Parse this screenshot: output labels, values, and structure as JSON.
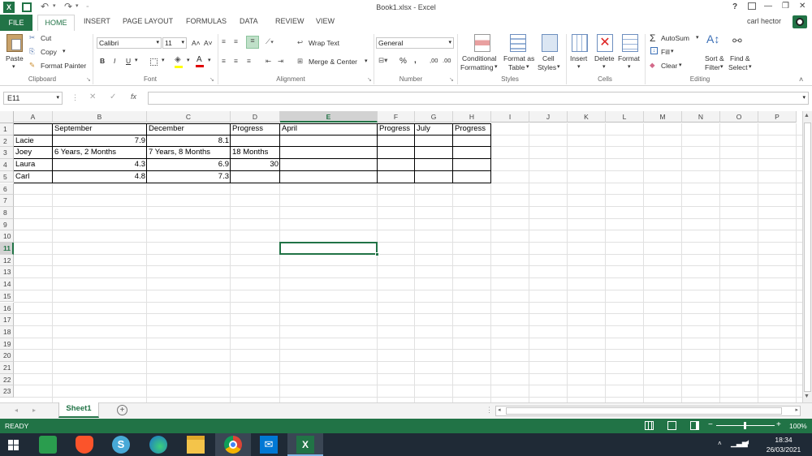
{
  "titlebar": {
    "title": "Book1.xlsx - Excel",
    "help": "?",
    "minimize": "—",
    "restore": "❐",
    "close": "✕"
  },
  "tabs": {
    "file": "FILE",
    "home": "HOME",
    "insert": "INSERT",
    "page_layout": "PAGE LAYOUT",
    "formulas": "FORMULAS",
    "data": "DATA",
    "review": "REVIEW",
    "view": "VIEW"
  },
  "user": {
    "name": "carl hector"
  },
  "ribbon": {
    "clipboard": {
      "paste": "Paste",
      "cut": "Cut",
      "copy": "Copy",
      "format_painter": "Format Painter",
      "group": "Clipboard"
    },
    "font": {
      "family": "Calibri",
      "size": "11",
      "bold": "B",
      "italic": "I",
      "underline": "U",
      "grow": "A˄",
      "shrink": "A˅",
      "group": "Font"
    },
    "alignment": {
      "wrap": "Wrap Text",
      "merge": "Merge & Center",
      "group": "Alignment"
    },
    "number": {
      "format": "General",
      "percent": "%",
      "comma": ",",
      "inc": ",00",
      "dec": ".00",
      "group": "Number"
    },
    "styles": {
      "conditional": "Conditional",
      "conditional2": "Formatting",
      "format_table": "Format as",
      "format_table2": "Table",
      "cell_styles": "Cell",
      "cell_styles2": "Styles",
      "group": "Styles"
    },
    "cells": {
      "insert": "Insert",
      "delete": "Delete",
      "format": "Format",
      "group": "Cells"
    },
    "editing": {
      "autosum": "AutoSum",
      "fill": "Fill",
      "clear": "Clear",
      "sort": "Sort &",
      "sort2": "Filter",
      "find": "Find &",
      "find2": "Select",
      "group": "Editing"
    }
  },
  "formula_bar": {
    "name_box": "E11",
    "fx": "fx",
    "cancel": "✕",
    "enter": "✓",
    "value": ""
  },
  "columns": [
    "A",
    "B",
    "C",
    "D",
    "E",
    "F",
    "G",
    "H",
    "I",
    "J",
    "K",
    "L",
    "M",
    "N",
    "O",
    "P"
  ],
  "rows": [
    "1",
    "2",
    "3",
    "4",
    "5",
    "6",
    "7",
    "8",
    "9",
    "10",
    "11",
    "12",
    "13",
    "14",
    "15",
    "16",
    "17",
    "18",
    "19",
    "20",
    "21",
    "22",
    "23"
  ],
  "cells": {
    "b1": "September",
    "c1": "December",
    "d1": "Progress",
    "e1": "April",
    "f1": "Progress",
    "g1": "July",
    "h1": "Progress",
    "a2": "Lacie",
    "b2": "7.9",
    "c2": "8.1",
    "a3": "Joey",
    "b3": "6 Years, 2 Months",
    "c3": "7 Years, 8 Months",
    "d3": "18 Months",
    "a4": "Laura",
    "b4": "4.3",
    "c4": "6.9",
    "d4": "30",
    "a5": "Carl",
    "b5": "4.8",
    "c5": "7.3"
  },
  "sheet": {
    "tab": "Sheet1",
    "add": "+"
  },
  "status": {
    "ready": "READY",
    "zoom": "100%",
    "minus": "−",
    "plus": "+"
  },
  "taskbar": {
    "time": "18:34",
    "date": "26/03/2021"
  },
  "colors": {
    "excel_green": "#217346",
    "active_col": "#217346",
    "taskbar": "#1f2a36"
  }
}
